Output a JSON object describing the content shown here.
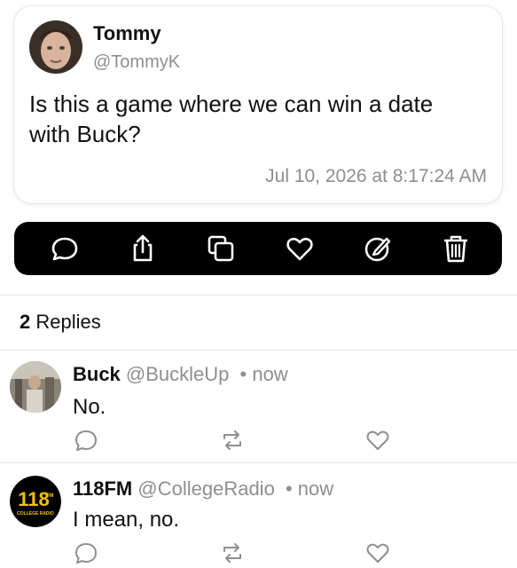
{
  "post": {
    "author_name": "Tommy",
    "author_handle": "@TommyK",
    "text": "Is this a game where we can win a date with Buck?",
    "timestamp": "Jul 10, 2026 at 8:17:24 AM"
  },
  "toolbar": {
    "actions": [
      "reply-icon",
      "share-icon",
      "copy-icon",
      "like-icon",
      "edit-icon",
      "delete-icon"
    ]
  },
  "replies_section": {
    "count": "2",
    "label": "Replies"
  },
  "replies": [
    {
      "name": "Buck",
      "handle": "@BuckleUp",
      "time": "• now",
      "text": "No."
    },
    {
      "name": "118FM",
      "handle": "@CollegeRadio",
      "time": "• now",
      "text": "I mean, no.",
      "avatar_logo_number": "118",
      "avatar_logo_sup": "FM",
      "avatar_logo_caption": "COLLEGE RADIO"
    }
  ],
  "colors": {
    "toolbar_bg": "#000000",
    "secondary_text": "#8e8e93",
    "logo_yellow": "#f2c200"
  }
}
